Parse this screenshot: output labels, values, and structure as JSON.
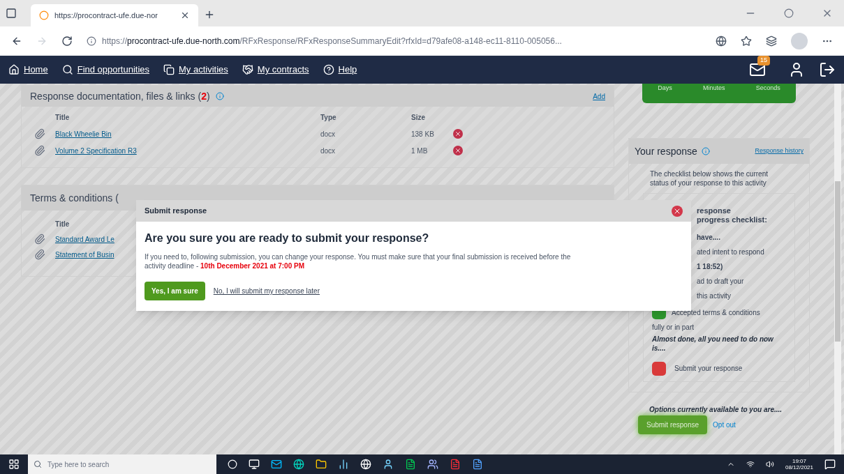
{
  "browser": {
    "tab_title": "https://procontract-ufe.due-nor",
    "url_scheme": "https://",
    "url_host": "procontract-ufe.due-north.com",
    "url_path": "/RFxResponse/RFxResponseSummaryEdit?rfxId=d79afe08-a148-ec11-8110-005056..."
  },
  "nav": {
    "items": [
      {
        "label": "Home",
        "kind": "home"
      },
      {
        "label": "Find opportunities",
        "kind": "search"
      },
      {
        "label": "My activities",
        "kind": "activities"
      },
      {
        "label": "My contracts",
        "kind": "contracts"
      },
      {
        "label": "Help",
        "kind": "help"
      }
    ],
    "mail_badge": "15"
  },
  "countdown": {
    "labels": [
      "Days",
      "Minutes",
      "Seconds"
    ]
  },
  "documents": {
    "title_before": "Response documentation, files & links (",
    "count": "2",
    "title_after": ")",
    "add": "Add",
    "columns": [
      "Title",
      "Type",
      "Size"
    ],
    "rows": [
      {
        "title": "Black Wheelie Bin",
        "type": "docx",
        "size": "138 KB"
      },
      {
        "title": "Volume 2 Specification R3",
        "type": "docx",
        "size": "1 MB"
      }
    ]
  },
  "terms": {
    "title": "Terms & conditions (",
    "columns": [
      "Title"
    ],
    "rows": [
      {
        "title": "Standard Award Le"
      },
      {
        "title": "Statement of Busin"
      }
    ]
  },
  "your_response": {
    "title": "Your response",
    "history": "Response history",
    "intro": "The checklist below shows the current status of your response to this activity",
    "checklist_heading": [
      "response",
      "progress checklist:"
    ],
    "have": "have....",
    "items": [
      {
        "lines": [
          "ated intent to respond"
        ],
        "bold_line": "1 18:52)"
      },
      {
        "lines": [
          "ad to draft your",
          "this activity"
        ]
      },
      {
        "color": "#2e9a2e",
        "lines": [
          "Accepted terms & conditions",
          "fully or in part"
        ]
      }
    ],
    "almost": "Almost done, all you need to do now is....",
    "todo": [
      {
        "color": "#d93a3a",
        "label": "Submit your response"
      }
    ],
    "options": "Options currently available to you are....",
    "submit": "Submit response",
    "opt_out": "Opt out"
  },
  "modal": {
    "title": "Submit response",
    "question": "Are you sure you are ready to submit your response?",
    "body": "If you need to, following submission, you can change your response. You must make sure that your final submission is received before the activity deadline - ",
    "deadline": "10th December 2021 at 7:00 PM",
    "yes": "Yes, I am sure",
    "no": "No, I will submit my response later"
  },
  "taskbar": {
    "search_placeholder": "Type here to search",
    "time": "19:07",
    "date": "08/12/2021"
  }
}
